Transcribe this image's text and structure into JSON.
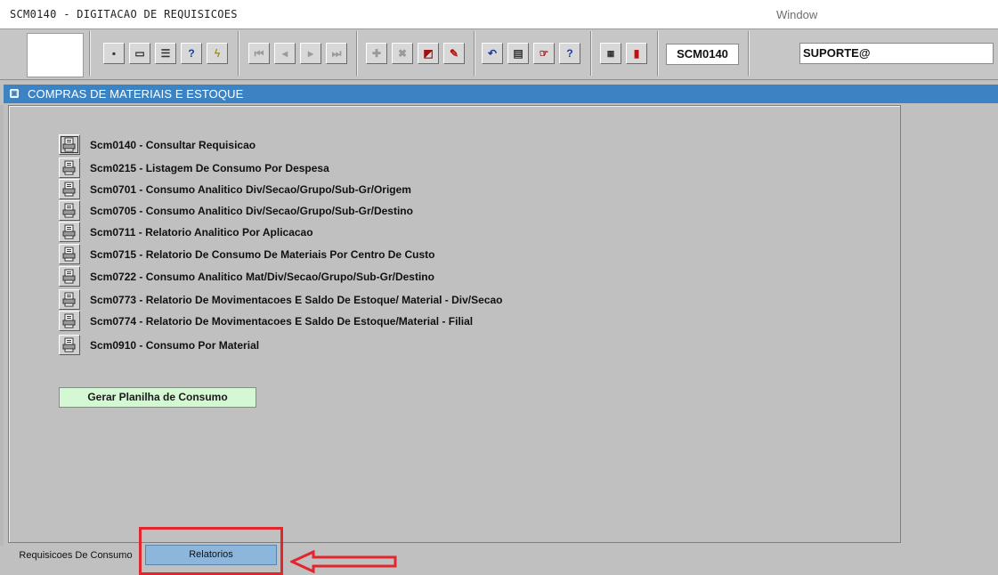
{
  "window": {
    "title": "SCM0140 - DIGITACAO DE REQUISICOES",
    "menu": "Window"
  },
  "toolbar": {
    "screen_code": "SCM0140",
    "user": "SUPORTE@"
  },
  "section": {
    "title": "COMPRAS DE MATERIAIS E ESTOQUE"
  },
  "reports": [
    {
      "code": "Scm0140",
      "label": "Consultar Requisicao"
    },
    {
      "code": "Scm0215",
      "label": "Listagem De Consumo Por Despesa"
    },
    {
      "code": "Scm0701",
      "label": "Consumo Analitico Div/Secao/Grupo/Sub-Gr/Origem"
    },
    {
      "code": "Scm0705",
      "label": "Consumo Analitico Div/Secao/Grupo/Sub-Gr/Destino"
    },
    {
      "code": "Scm0711",
      "label": "Relatorio Analitico Por Aplicacao"
    },
    {
      "code": "Scm0715",
      "label": "Relatorio De Consumo De Materiais Por Centro De Custo"
    },
    {
      "code": "Scm0722",
      "label": "Consumo Analitico Mat/Div/Secao/Grupo/Sub-Gr/Destino"
    },
    {
      "code": "Scm0773",
      "label": "Relatorio De Movimentacoes E Saldo De Estoque/ Material - Div/Secao"
    },
    {
      "code": "Scm0774",
      "label": "Relatorio De Movimentacoes E Saldo De Estoque/Material - Filial"
    },
    {
      "code": "Scm0910",
      "label": "Consumo Por Material"
    }
  ],
  "actions": {
    "gerar_planilha": "Gerar Planilha de Consumo"
  },
  "tabs": [
    {
      "label": "Requisicoes De Consumo"
    },
    {
      "label": "Relatorios"
    }
  ],
  "colors": {
    "section_header": "#3b83c3",
    "active_tab": "#8db6dd",
    "gerar_button": "#d4f7d4",
    "annotation": "#e3262d"
  }
}
